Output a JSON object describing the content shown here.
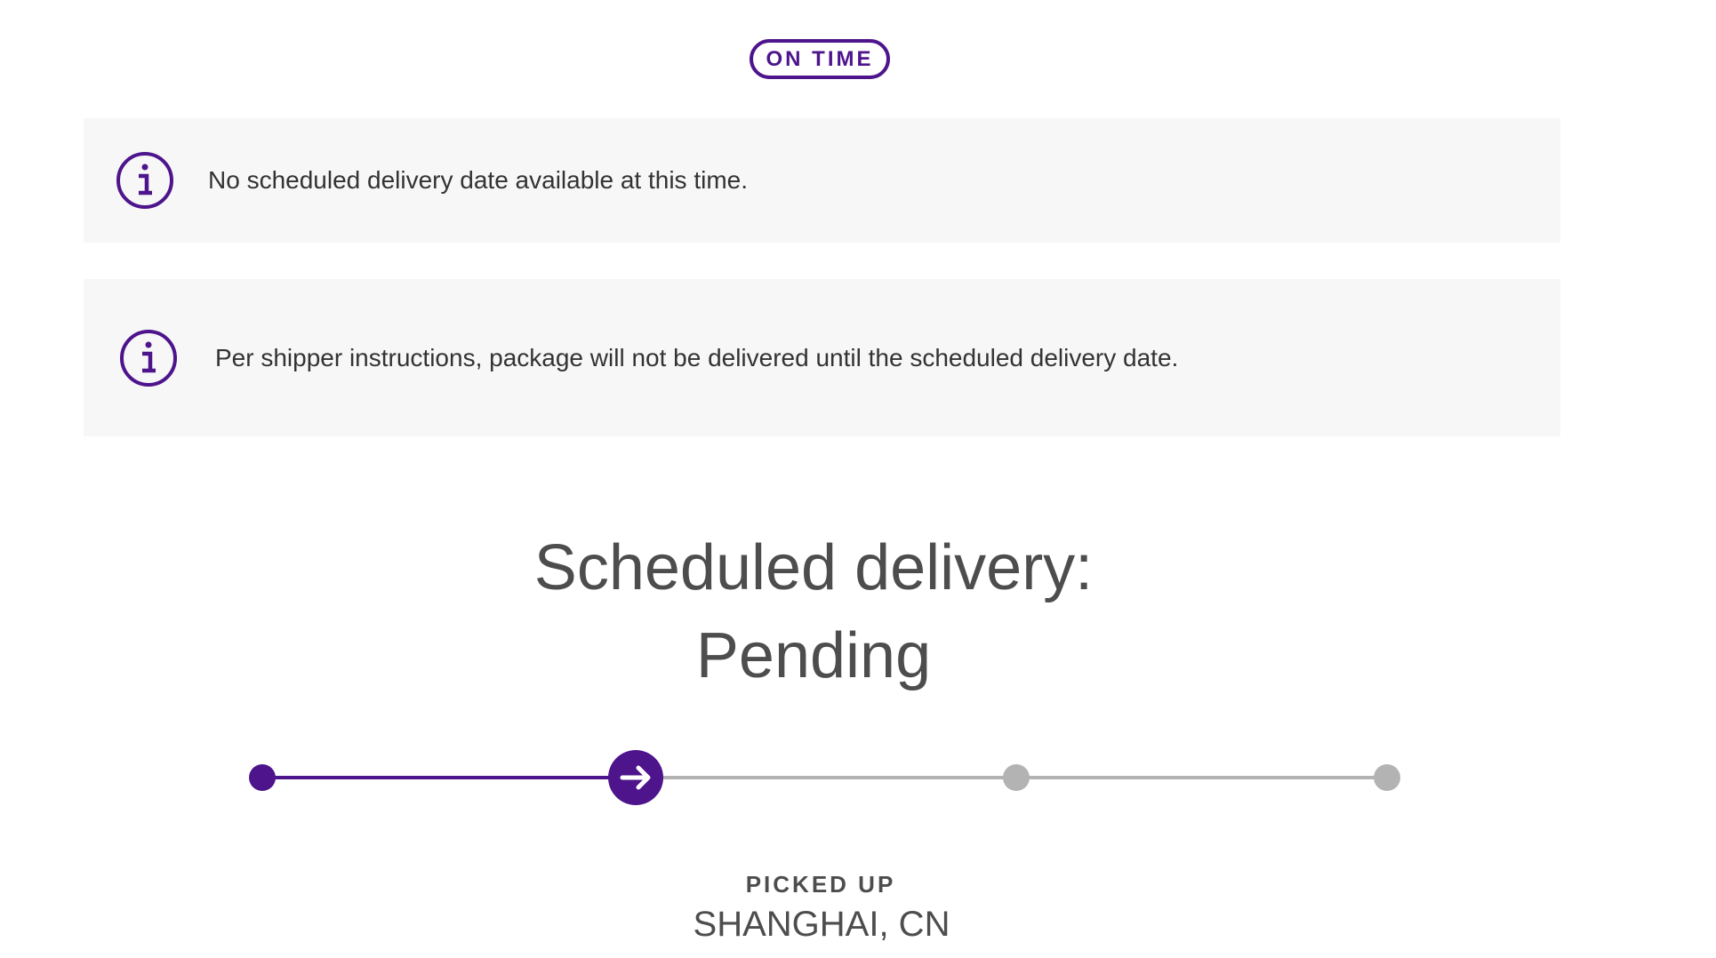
{
  "status_badge": {
    "label": "ON TIME"
  },
  "notices": [
    {
      "icon": "info-icon",
      "text": "No scheduled delivery date available at this time."
    },
    {
      "icon": "info-icon",
      "text": "Per shipper instructions, package will not be delivered until the scheduled delivery date."
    }
  ],
  "delivery": {
    "heading": "Scheduled delivery:",
    "value": "Pending"
  },
  "progress": {
    "steps_total": 4,
    "current_step": 2,
    "current_icon": "arrow-right-icon"
  },
  "latest_event": {
    "status": "PICKED UP",
    "location": "SHANGHAI, CN"
  },
  "colors": {
    "brand_purple": "#4d148c",
    "inactive_gray": "#b3b3b3",
    "notice_bg": "#f7f7f7",
    "text": "#333333"
  }
}
